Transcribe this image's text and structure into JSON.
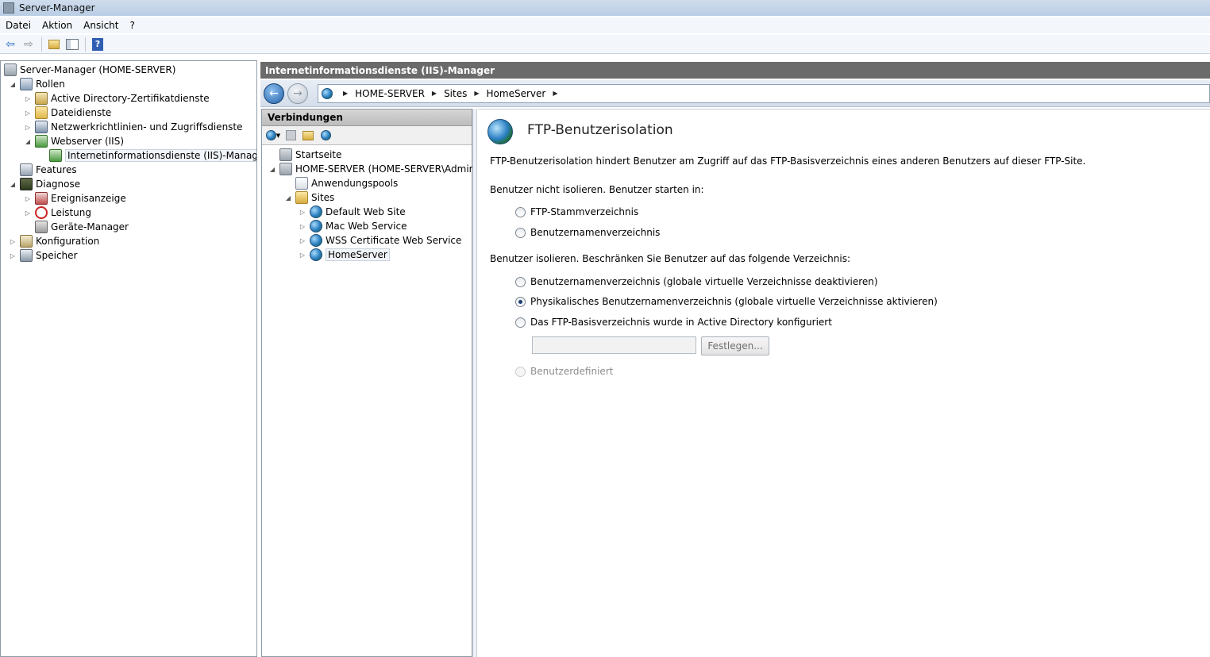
{
  "window": {
    "title": "Server-Manager"
  },
  "menubar": {
    "items": [
      "Datei",
      "Aktion",
      "Ansicht",
      "?"
    ]
  },
  "toolbar": {
    "icons": [
      "back-icon",
      "forward-icon",
      "folder-up-icon",
      "show-hide-console-tree-icon",
      "help-icon"
    ]
  },
  "left_tree": {
    "items": [
      {
        "label": "Server-Manager (HOME-SERVER)",
        "icon": "server-icon"
      },
      {
        "label": "Rollen",
        "icon": "roles-icon"
      },
      {
        "label": "Active Directory-Zertifikatdienste",
        "icon": "certificate-icon"
      },
      {
        "label": "Dateidienste",
        "icon": "folder-icon"
      },
      {
        "label": "Netzwerkrichtlinien- und Zugriffsdienste",
        "icon": "network-icon"
      },
      {
        "label": "Webserver (IIS)",
        "icon": "webserver-icon"
      },
      {
        "label": "Internetinformationsdienste (IIS)-Manager",
        "icon": "iis-manager-icon"
      },
      {
        "label": "Features",
        "icon": "features-icon"
      },
      {
        "label": "Diagnose",
        "icon": "diagnose-icon"
      },
      {
        "label": "Ereignisanzeige",
        "icon": "event-viewer-icon"
      },
      {
        "label": "Leistung",
        "icon": "performance-icon"
      },
      {
        "label": "Geräte-Manager",
        "icon": "device-manager-icon"
      },
      {
        "label": "Konfiguration",
        "icon": "configuration-icon"
      },
      {
        "label": "Speicher",
        "icon": "storage-icon"
      }
    ]
  },
  "iis": {
    "header": "Internetinformationsdienste (IIS)-Manager",
    "breadcrumb": [
      "HOME-SERVER",
      "Sites",
      "HomeServer"
    ]
  },
  "connections": {
    "title": "Verbindungen",
    "items": [
      {
        "label": "Startseite"
      },
      {
        "label": "HOME-SERVER (HOME-SERVER\\Administ"
      },
      {
        "label": "Anwendungspools"
      },
      {
        "label": "Sites"
      },
      {
        "label": "Default Web Site"
      },
      {
        "label": "Mac Web Service"
      },
      {
        "label": "WSS Certificate Web Service"
      },
      {
        "label": "HomeServer"
      }
    ]
  },
  "feature": {
    "title": "FTP-Benutzerisolation",
    "description": "FTP-Benutzerisolation hindert Benutzer am Zugriff auf das FTP-Basisverzeichnis eines anderen Benutzers auf dieser FTP-Site.",
    "section1_label": "Benutzer nicht isolieren. Benutzer starten in:",
    "section1_options": [
      "FTP-Stammverzeichnis",
      "Benutzernamenverzeichnis"
    ],
    "section2_label": "Benutzer isolieren. Beschränken Sie Benutzer auf das folgende Verzeichnis:",
    "section2_options": [
      "Benutzernamenverzeichnis (globale virtuelle Verzeichnisse deaktivieren)",
      "Physikalisches Benutzernamenverzeichnis (globale virtuelle Verzeichnisse aktivieren)",
      "Das FTP-Basisverzeichnis wurde in Active Directory konfiguriert"
    ],
    "selected_option": "Physikalisches Benutzernamenverzeichnis (globale virtuelle Verzeichnisse aktivieren)",
    "ad_path_value": "",
    "set_button": "Festlegen...",
    "custom_option": "Benutzerdefiniert"
  }
}
